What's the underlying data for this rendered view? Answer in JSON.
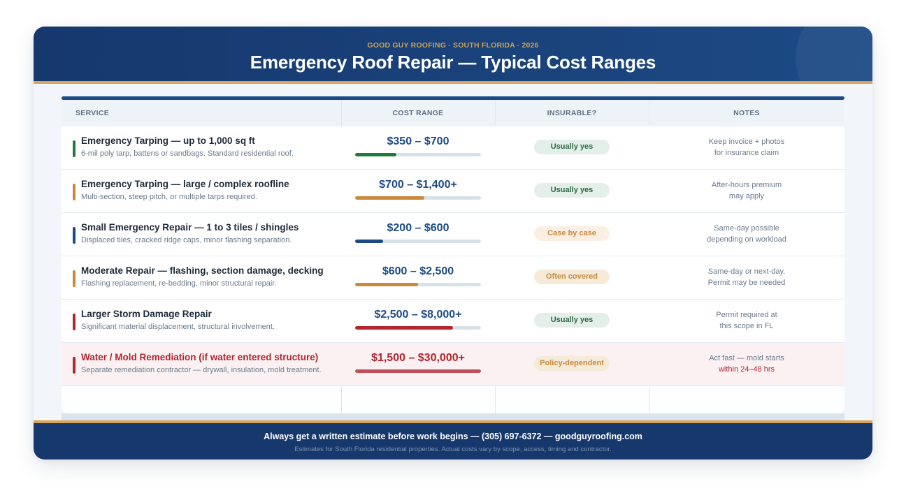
{
  "header": {
    "kicker": "GOOD GUY ROOFING · SOUTH FLORIDA · 2026",
    "title": "Emergency Roof Repair — Typical Cost Ranges"
  },
  "table": {
    "columns": [
      "SERVICE",
      "COST RANGE",
      "INSURABLE?",
      "NOTES"
    ],
    "rows": [
      {
        "title": "Emergency Tarping — up to 1,000 sq ft",
        "desc": "6-mil poly tarp, battens or sandbags. Standard residential roof.",
        "cost": "$350 – $700",
        "cost_level": 0.33,
        "accent_color": "#1f7a3d",
        "bar_color": "#1f7a3d",
        "badge": "Usually yes",
        "badge_style": "yes",
        "note1": "Keep invoice + photos",
        "note2": "for insurance claim"
      },
      {
        "title": "Emergency Tarping — large / complex roofline",
        "desc": "Multi-section, steep pitch, or multiple tarps required.",
        "cost": "$700 – $1,400+",
        "cost_level": 0.55,
        "accent_color": "#c98a3d",
        "bar_color": "#c98a3d",
        "badge": "Usually yes",
        "badge_style": "yes",
        "note1": "After-hours premium",
        "note2": "may apply"
      },
      {
        "title": "Small Emergency Repair — 1 to 3 tiles / shingles",
        "desc": "Displaced tiles, cracked ridge caps, minor flashing separation.",
        "cost": "$200 – $600",
        "cost_level": 0.22,
        "accent_color": "#1d4a85",
        "bar_color": "#1d4a85",
        "badge": "Case by case",
        "badge_style": "case",
        "note1": "Same-day possible",
        "note2": "depending on workload"
      },
      {
        "title": "Moderate Repair — flashing, section damage, decking",
        "desc": "Flashing replacement, re-bedding, minor structural repair.",
        "cost": "$600 – $2,500",
        "cost_level": 0.5,
        "accent_color": "#c98a3d",
        "bar_color": "#c98a3d",
        "badge": "Often covered",
        "badge_style": "policy",
        "note1": "Same-day or next-day.",
        "note2": "Permit may be needed"
      },
      {
        "title": "Larger Storm Damage Repair",
        "desc": "Significant material displacement, structural involvement.",
        "cost": "$2,500 – $8,000+",
        "cost_level": 0.78,
        "accent_color": "#b2262f",
        "bar_color": "#b2262f",
        "badge": "Usually yes",
        "badge_style": "yes",
        "note1": "Permit required at",
        "note2": "this scope in FL"
      },
      {
        "title": "Water / Mold Remediation (if water entered structure)",
        "desc": "Separate remediation contractor — drywall, insulation, mold treatment.",
        "cost": "$1,500 – $30,000+",
        "cost_level": 1.0,
        "accent_color": "#b2262f",
        "bar_color": "#c0505a",
        "badge": "Policy-dependent",
        "badge_style": "policy",
        "note1": "Act fast — mold starts",
        "note2": "within 24–48 hrs",
        "highlight": true
      }
    ]
  },
  "footer": {
    "main": "Always get a written estimate before work begins — (305) 697-6372 — goodguyroofing.com",
    "sub": "Estimates for South Florida residential properties. Actual costs vary by scope, access, timing and contractor."
  }
}
